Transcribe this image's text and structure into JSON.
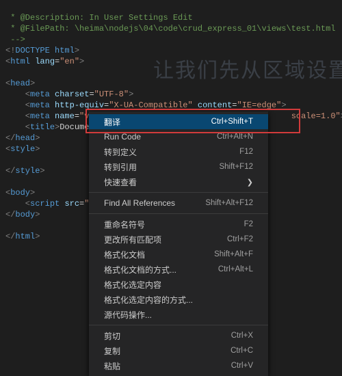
{
  "watermark": "让我们先从区域设置",
  "code": {
    "l1a": " * @Description: In User Settings Edit",
    "l2a": " * @FilePath: \\heima\\nodejs\\04\\code\\crud_express_01\\views\\test.html",
    "l3a": " -->",
    "doctype_open": "<!",
    "doctype_kw": "DOCTYPE",
    "doctype_rest": " html",
    "doctype_close": ">",
    "html_open1": "<",
    "html_tag": "html",
    "html_sp": " ",
    "html_attr": "lang",
    "html_eq": "=",
    "html_val": "\"en\"",
    "html_close": ">",
    "head_open": "<",
    "head_tag": "head",
    "head_close": ">",
    "meta1_open": "    <",
    "meta_tag": "meta",
    "meta1_sp": " ",
    "meta1_attr": "charset",
    "meta1_eq": "=",
    "meta1_val": "\"UTF-8\"",
    "meta1_close": ">",
    "meta2_open": "    <",
    "meta2_sp": " ",
    "meta2_attr": "http-equiv",
    "meta2_eq": "=",
    "meta2_val": "\"X-UA-Compatible\"",
    "meta2_sp2": " ",
    "meta2_attr2": "content",
    "meta2_eq2": "=",
    "meta2_val2": "\"IE=edge\"",
    "meta2_close": ">",
    "meta3_open": "    <",
    "meta3_sp": " ",
    "meta3_attr": "name",
    "meta3_eq": "=",
    "meta3_val": "\"vi",
    "meta3_tail": "scale=1.0\"",
    "meta3_close": ">",
    "title_open": "    <",
    "title_tag": "title",
    "title_close1": ">",
    "title_text": "Documen",
    "head_end_open": "</",
    "head_end_close": ">",
    "style_open": "<",
    "style_tag": "style",
    "style_close": ">",
    "style_end_open": "</",
    "style_end_close": ">",
    "body_open": "<",
    "body_tag": "body",
    "body_close": ">",
    "script_open": "    <",
    "script_tag": "script",
    "script_sp": " ",
    "script_attr": "src",
    "script_eq": "=",
    "script_val": "\".",
    "body_end_open": "</",
    "body_end_close": ">",
    "html_end_open": "</",
    "html_end_close": ">"
  },
  "menu": [
    {
      "label": "翻译",
      "key": "Ctrl+Shift+T",
      "sel": true
    },
    {
      "label": "Run Code",
      "key": "Ctrl+Alt+N"
    },
    {
      "label": "转到定义",
      "key": "F12"
    },
    {
      "label": "转到引用",
      "key": "Shift+F12"
    },
    {
      "label": "快速查看",
      "sub": true
    },
    {
      "sep": true
    },
    {
      "label": "Find All References",
      "key": "Shift+Alt+F12"
    },
    {
      "sep": true
    },
    {
      "label": "重命名符号",
      "key": "F2"
    },
    {
      "label": "更改所有匹配项",
      "key": "Ctrl+F2"
    },
    {
      "label": "格式化文档",
      "key": "Shift+Alt+F"
    },
    {
      "label": "格式化文档的方式...",
      "key": "Ctrl+Alt+L"
    },
    {
      "label": "格式化选定内容"
    },
    {
      "label": "格式化选定内容的方式..."
    },
    {
      "label": "源代码操作..."
    },
    {
      "sep": true
    },
    {
      "label": "剪切",
      "key": "Ctrl+X"
    },
    {
      "label": "复制",
      "key": "Ctrl+C"
    },
    {
      "label": "粘贴",
      "key": "Ctrl+V"
    }
  ]
}
